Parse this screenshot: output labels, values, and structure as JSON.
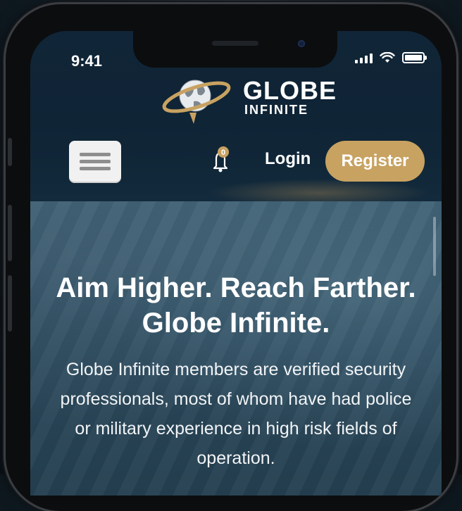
{
  "status_bar": {
    "time": "9:41",
    "icons": [
      "signal-icon",
      "wifi-icon",
      "battery-icon"
    ]
  },
  "header": {
    "logo": {
      "line1": "GLOBE",
      "line2": "INFINITE",
      "icon": "globe-orbit-icon"
    },
    "menu_icon": "hamburger-icon",
    "notification": {
      "icon": "bell-icon",
      "count": "0"
    },
    "login_label": "Login",
    "register_label": "Register"
  },
  "hero": {
    "title": "Aim Higher. Reach Farther. Globe Infinite.",
    "body": "Globe Infinite members are verified security professionals, most of whom have had police or military experience in high risk fields of operation."
  },
  "colors": {
    "accent": "#c8a261",
    "header_bg": "#0f2435",
    "hero_bg": "#2c4a5d"
  }
}
